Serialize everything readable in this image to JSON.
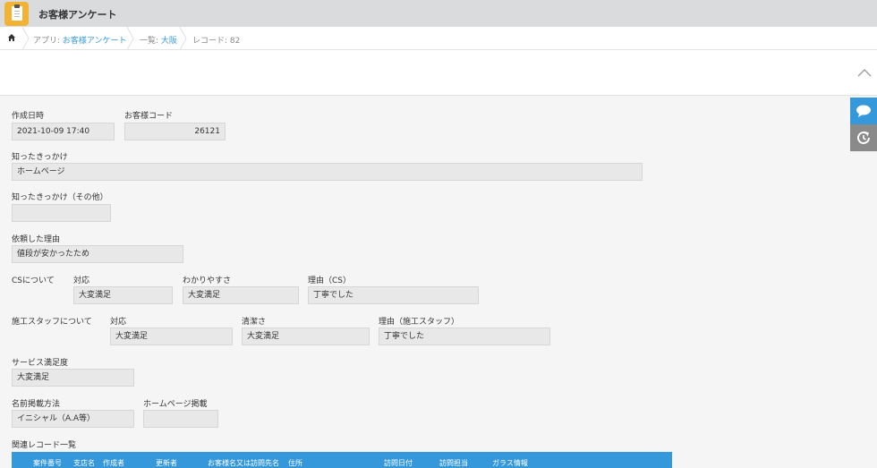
{
  "header": {
    "app_title": "お客様アンケート"
  },
  "breadcrumb": {
    "app_prefix": "アプリ: ",
    "app_name": "お客様アンケート",
    "list_prefix": "一覧: ",
    "list_name": "大阪",
    "record": "レコード: 82"
  },
  "form": {
    "created_label": "作成日時",
    "created_value": "2021-10-09 17:40",
    "customer_code_label": "お客様コード",
    "customer_code_value": "26121",
    "trigger_label": "知ったきっかけ",
    "trigger_value": "ホームページ",
    "trigger_other_label": "知ったきっかけ（その他）",
    "trigger_other_value": "",
    "reason_label": "依頼した理由",
    "reason_value": "値段が安かったため",
    "cs_label": "CSについて",
    "cs_response_label": "対応",
    "cs_response_value": "大変満足",
    "cs_clarity_label": "わかりやすさ",
    "cs_clarity_value": "大変満足",
    "cs_reason_label": "理由（CS）",
    "cs_reason_value": "丁寧でした",
    "staff_label": "施工スタッフについて",
    "staff_response_label": "対応",
    "staff_response_value": "大変満足",
    "staff_clean_label": "清潔さ",
    "staff_clean_value": "大変満足",
    "staff_reason_label": "理由（施工スタッフ）",
    "staff_reason_value": "丁寧でした",
    "service_label": "サービス満足度",
    "service_value": "大変満足",
    "name_method_label": "名前掲載方法",
    "name_method_value": "イニシャル（A.A等）",
    "homepage_label": "ホームページ掲載",
    "homepage_value": "",
    "related_label": "関連レコード一覧"
  },
  "related_table": {
    "columns": [
      "案件番号",
      "支店名",
      "作成者",
      "更新者",
      "お客様名又は訪問先名",
      "住所",
      "訪問日付",
      "訪問担当",
      "ガラス情報"
    ]
  },
  "colors": {
    "accent": "#3498db",
    "app_icon": "#f2b233",
    "header_bg": "#d9dbdc"
  }
}
